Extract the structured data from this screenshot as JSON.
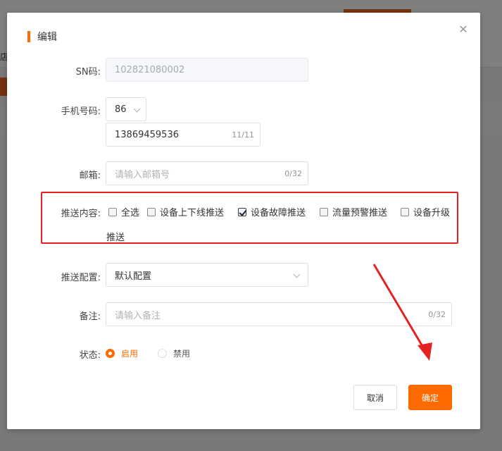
{
  "background": {
    "side_text": "店"
  },
  "dialog": {
    "title": "编辑",
    "close_icon": "close-icon",
    "sn": {
      "label": "SN码:",
      "value": "102821080002"
    },
    "phone": {
      "label": "手机号码:",
      "country_code": "86",
      "value": "13869459536",
      "count": "11/11"
    },
    "email": {
      "label": "邮箱:",
      "placeholder": "请输入邮箱号",
      "count": "0/32"
    },
    "push_content": {
      "label": "推送内容:",
      "options": [
        {
          "label": "全选",
          "checked": false
        },
        {
          "label": "设备上下线推送",
          "checked": false
        },
        {
          "label": "设备故障推送",
          "checked": true
        },
        {
          "label": "流量预警推送",
          "checked": false
        },
        {
          "label": "设备升级",
          "checked": false
        }
      ],
      "wrap_text": "推送"
    },
    "push_config": {
      "label": "推送配置:",
      "value": "默认配置"
    },
    "remark": {
      "label": "备注:",
      "placeholder": "请输入备注",
      "count": "0/32"
    },
    "status": {
      "label": "状态:",
      "options": [
        {
          "label": "启用",
          "selected": true
        },
        {
          "label": "禁用",
          "selected": false
        }
      ]
    },
    "buttons": {
      "cancel": "取消",
      "confirm": "确定"
    }
  },
  "colors": {
    "accent": "#ff6a00",
    "highlight_box": "#e52222",
    "annotation_arrow": "#e52222"
  }
}
